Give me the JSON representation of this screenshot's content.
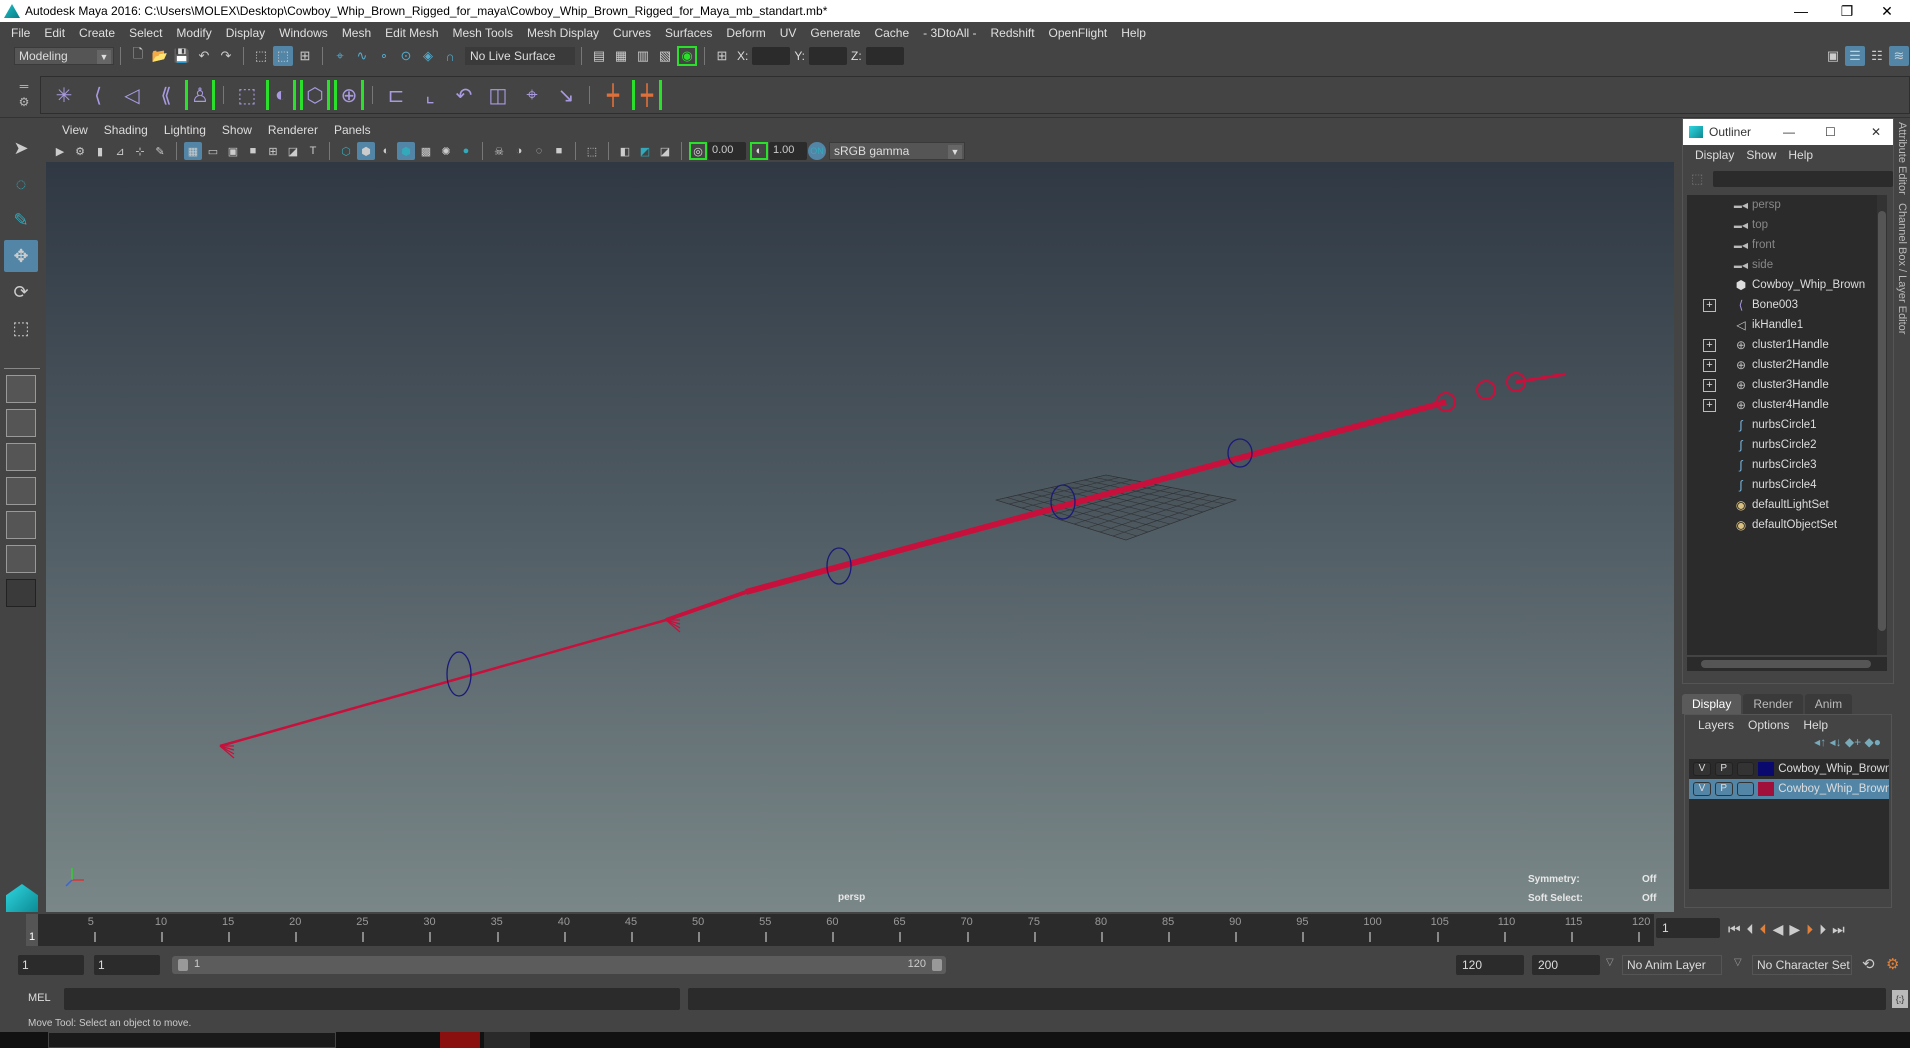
{
  "window": {
    "title": "Autodesk Maya 2016: C:\\Users\\MOLEX\\Desktop\\Cowboy_Whip_Brown_Rigged_for_maya\\Cowboy_Whip_Brown_Rigged_for_Maya_mb_standart.mb*",
    "controls": {
      "minimize": "—",
      "restore": "❐",
      "close": "✕"
    }
  },
  "menubar": [
    "File",
    "Edit",
    "Create",
    "Select",
    "Modify",
    "Display",
    "Windows",
    "Mesh",
    "Edit Mesh",
    "Mesh Tools",
    "Mesh Display",
    "Curves",
    "Surfaces",
    "Deform",
    "UV",
    "Generate",
    "Cache",
    "- 3DtoAll -",
    "Redshift",
    "OpenFlight",
    "Help"
  ],
  "statusline": {
    "mode": "Modeling",
    "live_surface": "No Live Surface",
    "x_label": "X:",
    "y_label": "Y:",
    "z_label": "Z:"
  },
  "shelf": {
    "icons": [
      "joint-tool",
      "ik-handle",
      "ik-spline",
      "bind-skin",
      "humanik",
      "paint-weights",
      "blend-shape",
      "lattice",
      "cluster",
      "parent-constraint",
      "point-constraint",
      "orient-constraint",
      "scale-constraint",
      "aim-constraint",
      "pole-vector-constraint",
      "set-key",
      "set-driven-key"
    ]
  },
  "toolbox": {
    "tools": [
      "select-tool",
      "lasso-tool",
      "paint-select-tool",
      "move-tool",
      "rotate-tool",
      "scale-tool"
    ],
    "active": "move-tool"
  },
  "viewport": {
    "menu": [
      "View",
      "Shading",
      "Lighting",
      "Show",
      "Renderer",
      "Panels"
    ],
    "exposure": "0.00",
    "gamma": "1.00",
    "color_space": "sRGB gamma",
    "camera_label": "persp",
    "hud": [
      {
        "label": "Symmetry:",
        "value": "Off"
      },
      {
        "label": "Soft Select:",
        "value": "Off"
      }
    ],
    "wire_color": "#c8103c",
    "control_color": "#1a1a7a"
  },
  "outliner": {
    "title": "Outliner",
    "menu": [
      "Display",
      "Show",
      "Help"
    ],
    "items": [
      {
        "name": "persp",
        "icon": "camera-icon",
        "dim": true,
        "expand": false
      },
      {
        "name": "top",
        "icon": "camera-icon",
        "dim": true,
        "expand": false
      },
      {
        "name": "front",
        "icon": "camera-icon",
        "dim": true,
        "expand": false
      },
      {
        "name": "side",
        "icon": "camera-icon",
        "dim": true,
        "expand": false
      },
      {
        "name": "Cowboy_Whip_Brown",
        "icon": "mesh-icon",
        "dim": false,
        "expand": false
      },
      {
        "name": "Bone003",
        "icon": "joint-icon",
        "dim": false,
        "expand": true
      },
      {
        "name": "ikHandle1",
        "icon": "ik-handle-icon",
        "dim": false,
        "expand": false
      },
      {
        "name": "cluster1Handle",
        "icon": "cluster-icon",
        "dim": false,
        "expand": true
      },
      {
        "name": "cluster2Handle",
        "icon": "cluster-icon",
        "dim": false,
        "expand": true
      },
      {
        "name": "cluster3Handle",
        "icon": "cluster-icon",
        "dim": false,
        "expand": true
      },
      {
        "name": "cluster4Handle",
        "icon": "cluster-icon",
        "dim": false,
        "expand": true
      },
      {
        "name": "nurbsCircle1",
        "icon": "curve-icon",
        "dim": false,
        "expand": false
      },
      {
        "name": "nurbsCircle2",
        "icon": "curve-icon",
        "dim": false,
        "expand": false
      },
      {
        "name": "nurbsCircle3",
        "icon": "curve-icon",
        "dim": false,
        "expand": false
      },
      {
        "name": "nurbsCircle4",
        "icon": "curve-icon",
        "dim": false,
        "expand": false
      },
      {
        "name": "defaultLightSet",
        "icon": "set-icon",
        "dim": false,
        "expand": false
      },
      {
        "name": "defaultObjectSet",
        "icon": "set-icon",
        "dim": false,
        "expand": false
      }
    ]
  },
  "side_tabs": [
    "Attribute Editor",
    "Channel Box / Layer Editor"
  ],
  "layer_editor": {
    "tabs": [
      "Display",
      "Render",
      "Anim"
    ],
    "active_tab": "Display",
    "menu": [
      "Layers",
      "Options",
      "Help"
    ],
    "layers": [
      {
        "v": "V",
        "p": "P",
        "color": "#0a0a6e",
        "name": "Cowboy_Whip_Brown_",
        "selected": false
      },
      {
        "v": "V",
        "p": "P",
        "color": "#a0103a",
        "name": "Cowboy_Whip_Brown_",
        "selected": true
      }
    ]
  },
  "timeline": {
    "start": 1,
    "end": 120,
    "ticks": [
      5,
      10,
      15,
      20,
      25,
      30,
      35,
      40,
      45,
      50,
      55,
      60,
      65,
      70,
      75,
      80,
      85,
      90,
      95,
      100,
      105,
      110,
      115,
      120
    ],
    "current_frame_label": "1",
    "current_frame_field": "1"
  },
  "range": {
    "start_time": "1",
    "playback_start": "1",
    "slider_start": "1",
    "slider_end": "120",
    "playback_end": "120",
    "end_time": "200",
    "anim_layer": "No Anim Layer",
    "character_set": "No Character Set"
  },
  "command_line": {
    "label": "MEL",
    "value": "",
    "result": ""
  },
  "help_line": "Move Tool: Select an object to move."
}
